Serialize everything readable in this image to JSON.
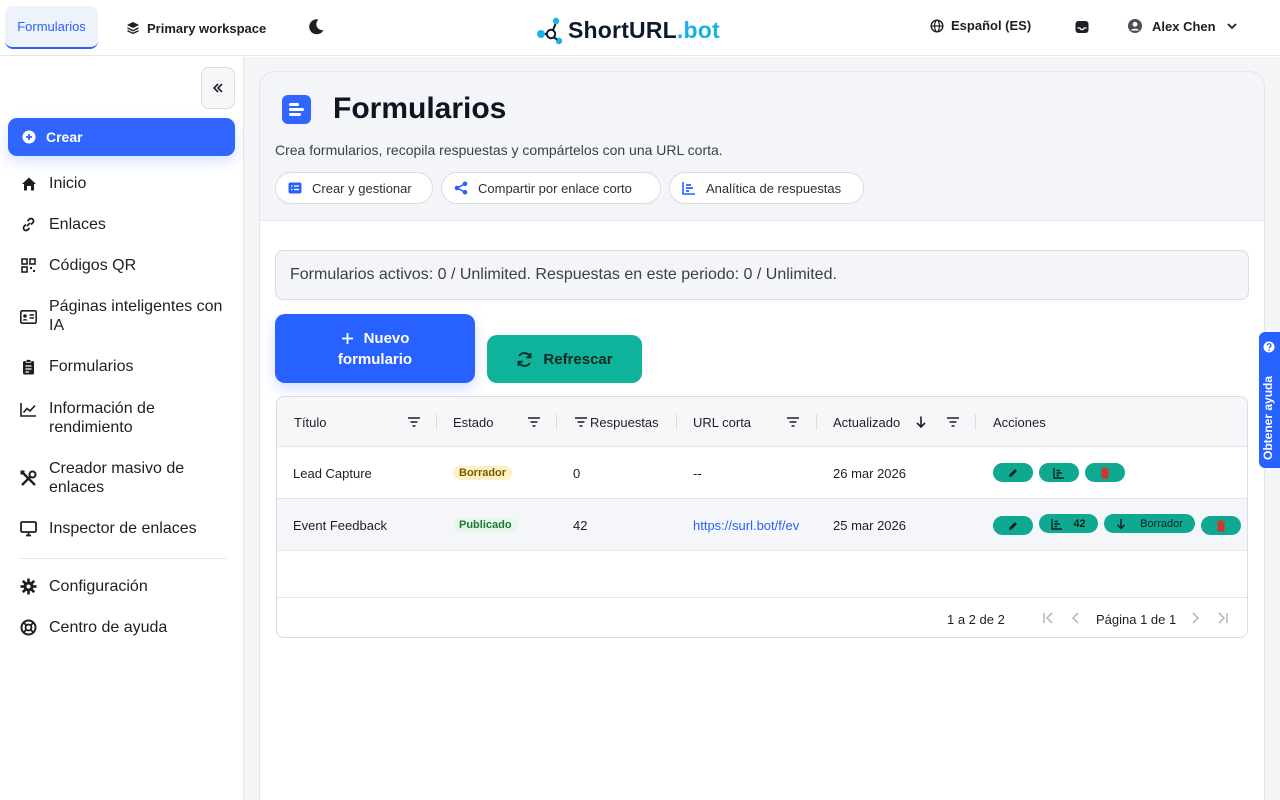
{
  "topbar": {
    "active_tab": "Formularios",
    "workspace": "Primary workspace",
    "brand_short": "ShortURL",
    "brand_tld": ".bot",
    "language": "Español (ES)",
    "user_name": "Alex Chen"
  },
  "sidebar": {
    "create_label": "Crear",
    "items": [
      {
        "label": "Inicio",
        "icon": "home-icon"
      },
      {
        "label": "Enlaces",
        "icon": "link-icon"
      },
      {
        "label": "Códigos QR",
        "icon": "qr-icon"
      },
      {
        "label": "Páginas inteligentes con IA",
        "icon": "id-card-icon"
      },
      {
        "label": "Formularios",
        "icon": "clipboard-icon"
      },
      {
        "label": "Información de rendimiento",
        "icon": "chart-line-icon"
      },
      {
        "label": "Creador masivo de enlaces",
        "icon": "tools-icon"
      },
      {
        "label": "Inspector de enlaces",
        "icon": "monitor-icon"
      }
    ],
    "footer_items": [
      {
        "label": "Configuración",
        "icon": "gear-icon"
      },
      {
        "label": "Centro de ayuda",
        "icon": "lifebuoy-icon"
      }
    ]
  },
  "page": {
    "title": "Formularios",
    "subtitle": "Crea formularios, recopila respuestas y compártelos con una URL corta.",
    "chips": [
      "Crear y gestionar",
      "Compartir por enlace corto",
      "Analítica de respuestas"
    ],
    "quota": "Formularios activos: 0 / Unlimited. Respuestas en este periodo: 0 / Unlimited.",
    "new_form_line1": "Nuevo",
    "new_form_line2": "formulario",
    "refresh_label": "Refrescar"
  },
  "table": {
    "columns": [
      "Título",
      "Estado",
      "Respuestas",
      "URL corta",
      "Actualizado",
      "Acciones"
    ],
    "rows": [
      {
        "title": "Lead Capture",
        "status": "Borrador",
        "responses": "0",
        "url": "--",
        "updated": "26 mar 2026"
      },
      {
        "title": "Event Feedback",
        "status": "Publicado",
        "responses": "42",
        "url": "https://surl.bot/f/ev",
        "updated": "25 mar 2026",
        "stats_count": "42",
        "unpublish_label": "Borrador"
      }
    ],
    "pager_range": "1 a 2 de 2",
    "pager_page": "Página 1 de 1"
  },
  "help_tab": "Obtener ayuda",
  "colors": {
    "primary": "#2761ff",
    "teal": "#0fb39b",
    "brand_tld": "#1ab0e8",
    "danger": "#d6332a"
  }
}
